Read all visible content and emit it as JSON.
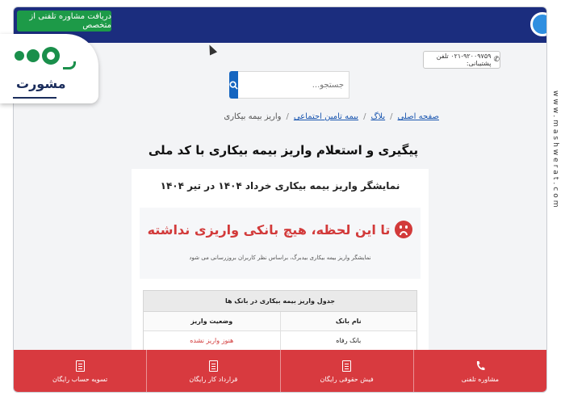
{
  "topbar": {
    "consult_label": "دریافت مشاوره تلفنی از متخصص"
  },
  "logo": {
    "text": "مشورت"
  },
  "header": {
    "phone": "۰۲۱-۹۲۰۰۹۷۵۹ تلفن پشتیبانی:"
  },
  "search": {
    "placeholder": "جستجو..."
  },
  "breadcrumb": {
    "items": [
      "صفحه اصلی",
      "بلاگ",
      "بیمه تامین اجتماعی"
    ],
    "current": "واریز بیمه بیکاری"
  },
  "page": {
    "title": "پیگیری و استعلام واریز بیمه بیکاری با کد ملی"
  },
  "card": {
    "heading": "نمایشگر واریز بیمه بیکاری خرداد ۱۴۰۴ در تیر ۱۴۰۴",
    "notice_title": "تا این لحظه، هیچ بانکی واریزی نداشته",
    "notice_sub": "نمایشگر واریز بیمه بیکاری بیدبرگ، براساس نظر کاربران بروزرسانی می شود",
    "table": {
      "caption": "جدول واریز بیمه بیکاری در بانک ها",
      "headers": [
        "نام بانک",
        "وضعیت واریز"
      ],
      "rows": [
        [
          "بانک رفاه",
          "هنوز واریز نشده"
        ]
      ]
    }
  },
  "bottom_bar": {
    "items": [
      "مشاوره تلفنی",
      "فیش حقوقی رایگان",
      "قرارداد کار رایگان",
      "تسویه حساب رایگان"
    ]
  },
  "watermark": "www.mashwerat.com",
  "colors": {
    "topbar": "#1b2d7e",
    "consult_button": "#1d9a48",
    "bottom_bar": "#d83a3f",
    "alert_red": "#d23a3a",
    "link_blue": "#1a56b0",
    "logo_green": "#1a8f4b"
  }
}
